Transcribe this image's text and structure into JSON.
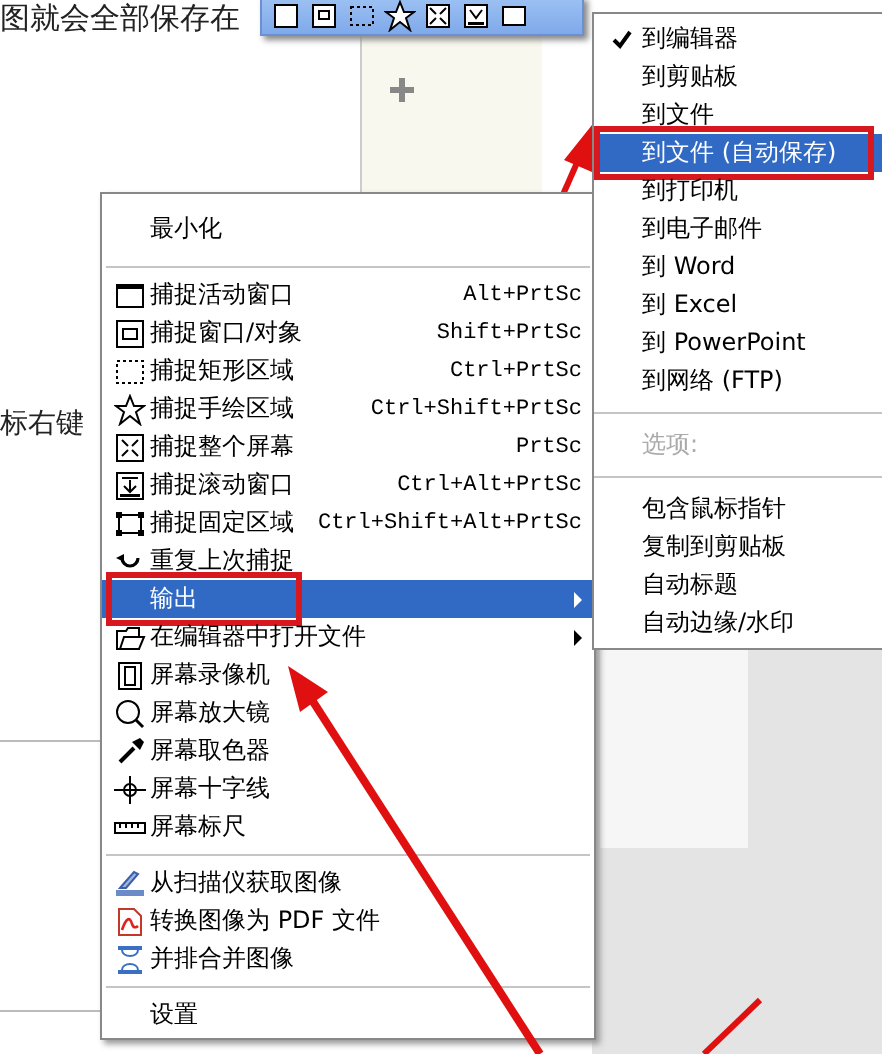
{
  "background": {
    "texts": [
      "图就会全部保存在",
      "标右键"
    ]
  },
  "menu": {
    "items": [
      {
        "kind": "item",
        "label": "最小化",
        "selected": false,
        "outlined": false
      },
      {
        "kind": "separator"
      },
      {
        "kind": "item",
        "label": "捕捉活动窗口",
        "shortcut": "Alt+PrtSc",
        "selected": false,
        "outlined": false
      },
      {
        "kind": "item",
        "label": "捕捉窗口/对象",
        "shortcut": "Shift+PrtSc",
        "selected": false,
        "outlined": false
      },
      {
        "kind": "item",
        "label": "捕捉矩形区域",
        "shortcut": "Ctrl+PrtSc",
        "selected": false,
        "outlined": false
      },
      {
        "kind": "item",
        "label": "捕捉手绘区域",
        "shortcut": "Ctrl+Shift+PrtSc",
        "selected": false,
        "outlined": false
      },
      {
        "kind": "item",
        "label": "捕捉整个屏幕",
        "shortcut": "PrtSc",
        "selected": false,
        "outlined": false
      },
      {
        "kind": "item",
        "label": "捕捉滚动窗口",
        "shortcut": "Ctrl+Alt+PrtSc",
        "selected": false,
        "outlined": false
      },
      {
        "kind": "item",
        "label": "捕捉固定区域",
        "shortcut": "Ctrl+Shift+Alt+PrtSc",
        "selected": false,
        "outlined": false
      },
      {
        "kind": "item",
        "label": "重复上次捕捉",
        "selected": false,
        "outlined": false
      },
      {
        "kind": "submenu",
        "label": "输出",
        "selected": true,
        "outlined": true
      },
      {
        "kind": "submenu",
        "label": "在编辑器中打开文件",
        "selected": false,
        "outlined": false
      },
      {
        "kind": "item",
        "label": "屏幕录像机",
        "selected": false,
        "outlined": false
      },
      {
        "kind": "item",
        "label": "屏幕放大镜",
        "selected": false,
        "outlined": false
      },
      {
        "kind": "item",
        "label": "屏幕取色器",
        "selected": false,
        "outlined": false
      },
      {
        "kind": "item",
        "label": "屏幕十字线",
        "selected": false,
        "outlined": false
      },
      {
        "kind": "item",
        "label": "屏幕标尺",
        "selected": false,
        "outlined": false
      },
      {
        "kind": "separator"
      },
      {
        "kind": "item",
        "label": "从扫描仪获取图像",
        "selected": false,
        "outlined": false
      },
      {
        "kind": "item",
        "label": "转换图像为 PDF 文件",
        "selected": false,
        "outlined": false
      },
      {
        "kind": "item",
        "label": "并排合并图像",
        "selected": false,
        "outlined": false
      },
      {
        "kind": "separator"
      },
      {
        "kind": "item",
        "label": "设置",
        "selected": false,
        "outlined": false
      }
    ]
  },
  "submenu": {
    "items": [
      {
        "kind": "item",
        "label": "到编辑器",
        "checked": true,
        "selected": false,
        "outlined": false
      },
      {
        "kind": "item",
        "label": "到剪贴板",
        "checked": false,
        "selected": false,
        "outlined": false
      },
      {
        "kind": "item",
        "label": "到文件",
        "checked": false,
        "selected": false,
        "outlined": false
      },
      {
        "kind": "item",
        "label": "到文件 (自动保存)",
        "checked": false,
        "selected": true,
        "outlined": true
      },
      {
        "kind": "item",
        "label": "到打印机",
        "checked": false,
        "selected": false,
        "outlined": false
      },
      {
        "kind": "item",
        "label": "到电子邮件",
        "checked": false,
        "selected": false,
        "outlined": false
      },
      {
        "kind": "item",
        "label": "到 Word",
        "checked": false,
        "selected": false,
        "outlined": false
      },
      {
        "kind": "item",
        "label": "到 Excel",
        "checked": false,
        "selected": false,
        "outlined": false
      },
      {
        "kind": "item",
        "label": "到 PowerPoint",
        "checked": false,
        "selected": false,
        "outlined": false
      },
      {
        "kind": "item",
        "label": "到网络 (FTP)",
        "checked": false,
        "selected": false,
        "outlined": false
      },
      {
        "kind": "separator"
      },
      {
        "kind": "item",
        "label": "选项:",
        "disabled": true,
        "checked": false,
        "selected": false,
        "outlined": false
      },
      {
        "kind": "separator"
      },
      {
        "kind": "item",
        "label": "包含鼠标指针",
        "checked": false,
        "selected": false,
        "outlined": false
      },
      {
        "kind": "item",
        "label": "复制到剪贴板",
        "checked": false,
        "selected": false,
        "outlined": false
      },
      {
        "kind": "item",
        "label": "自动标题",
        "checked": false,
        "selected": false,
        "outlined": false
      },
      {
        "kind": "item",
        "label": "自动边缘/水印",
        "checked": false,
        "selected": false,
        "outlined": false
      }
    ]
  }
}
